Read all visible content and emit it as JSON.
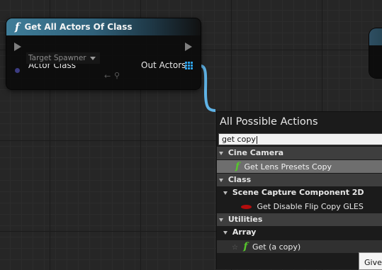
{
  "node": {
    "title": "Get All Actors Of Class",
    "actor_class_label": "Actor Class",
    "actor_class_value": "Target Spawner",
    "out_actors_label": "Out Actors"
  },
  "menu": {
    "title": "All Possible Actions",
    "search_value": "get copy",
    "items": [
      {
        "kind": "category",
        "label": "Cine Camera"
      },
      {
        "kind": "action",
        "icon": "function-icon",
        "label": "Get Lens Presets Copy",
        "selected": true
      },
      {
        "kind": "category",
        "label": "Class"
      },
      {
        "kind": "subcategory",
        "label": "Scene Capture Component 2D"
      },
      {
        "kind": "action",
        "icon": "red-component-icon",
        "label": "Get Disable Flip Copy GLES"
      },
      {
        "kind": "category",
        "label": "Utilities"
      },
      {
        "kind": "subcategory",
        "label": "Array"
      },
      {
        "kind": "action",
        "icon": "function-icon",
        "label": "Get (a copy)",
        "favorite": true
      }
    ]
  },
  "tooltip": {
    "text": "Giver"
  },
  "colors": {
    "node_header": "#3f7d98",
    "wire": "#5fb3e6",
    "pin_blue": "#2da0e8",
    "function_green": "#57c72c",
    "selection": "#6e6e6e"
  }
}
